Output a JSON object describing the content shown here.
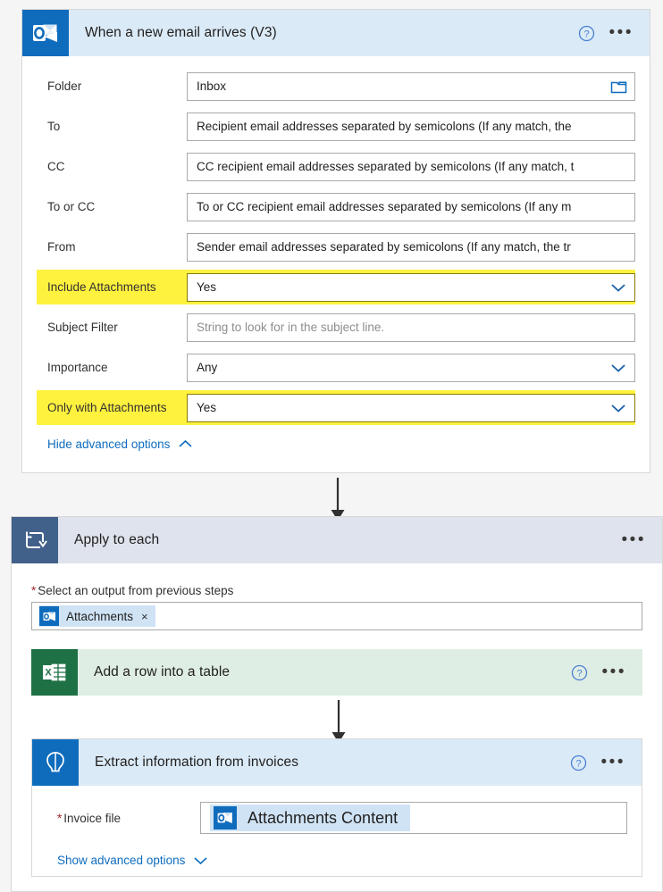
{
  "trigger": {
    "title": "When a new email arrives (V3)",
    "icon": "outlook-icon",
    "help_icon": "help-circle-icon",
    "menu_icon": "ellipsis-icon",
    "fields": [
      {
        "label": "Folder",
        "value": "Inbox",
        "placeholder": "",
        "control": "folder-picker",
        "highlighted": false
      },
      {
        "label": "To",
        "value": "",
        "placeholder": "Recipient email addresses separated by semicolons (If any match, the",
        "control": "text",
        "highlighted": false
      },
      {
        "label": "CC",
        "value": "",
        "placeholder": "CC recipient email addresses separated by semicolons (If any match, t",
        "control": "text",
        "highlighted": false
      },
      {
        "label": "To or CC",
        "value": "",
        "placeholder": "To or CC recipient email addresses separated by semicolons (If any m",
        "control": "text",
        "highlighted": false
      },
      {
        "label": "From",
        "value": "",
        "placeholder": "Sender email addresses separated by semicolons (If any match, the tr",
        "control": "text",
        "highlighted": false
      },
      {
        "label": "Include Attachments",
        "value": "Yes",
        "placeholder": "",
        "control": "dropdown",
        "highlighted": true
      },
      {
        "label": "Subject Filter",
        "value": "",
        "placeholder": "String to look for in the subject line.",
        "control": "text",
        "highlighted": false
      },
      {
        "label": "Importance",
        "value": "Any",
        "placeholder": "",
        "control": "dropdown",
        "highlighted": false
      },
      {
        "label": "Only with Attachments",
        "value": "Yes",
        "placeholder": "",
        "control": "dropdown",
        "highlighted": true
      }
    ],
    "advanced_link": "Hide advanced options",
    "advanced_chevron": "chevron-up-icon"
  },
  "loop": {
    "title": "Apply to each",
    "icon": "loop-icon",
    "menu_icon": "ellipsis-icon",
    "input_label": "Select an output from previous steps",
    "required_marker": "*",
    "token": {
      "text": "Attachments",
      "icon": "outlook-icon",
      "remove": "×"
    },
    "actions": [
      {
        "title": "Add a row into a table",
        "icon": "excel-icon",
        "help_icon": "help-circle-icon",
        "menu_icon": "ellipsis-icon"
      },
      {
        "title": "Extract information from invoices",
        "icon": "ai-builder-icon",
        "help_icon": "help-circle-icon",
        "menu_icon": "ellipsis-icon",
        "field_label": "Invoice file",
        "required_marker": "*",
        "token": {
          "text": "Attachments Content",
          "icon": "outlook-icon"
        },
        "advanced_link": "Show advanced options",
        "advanced_chevron": "chevron-down-icon"
      }
    ]
  },
  "colors": {
    "accent_blue": "#0f6cbd",
    "highlight_yellow": "#fff23f",
    "excel_green": "#1e7145",
    "loop_slate": "#41618a",
    "required_red": "#a4262c"
  }
}
